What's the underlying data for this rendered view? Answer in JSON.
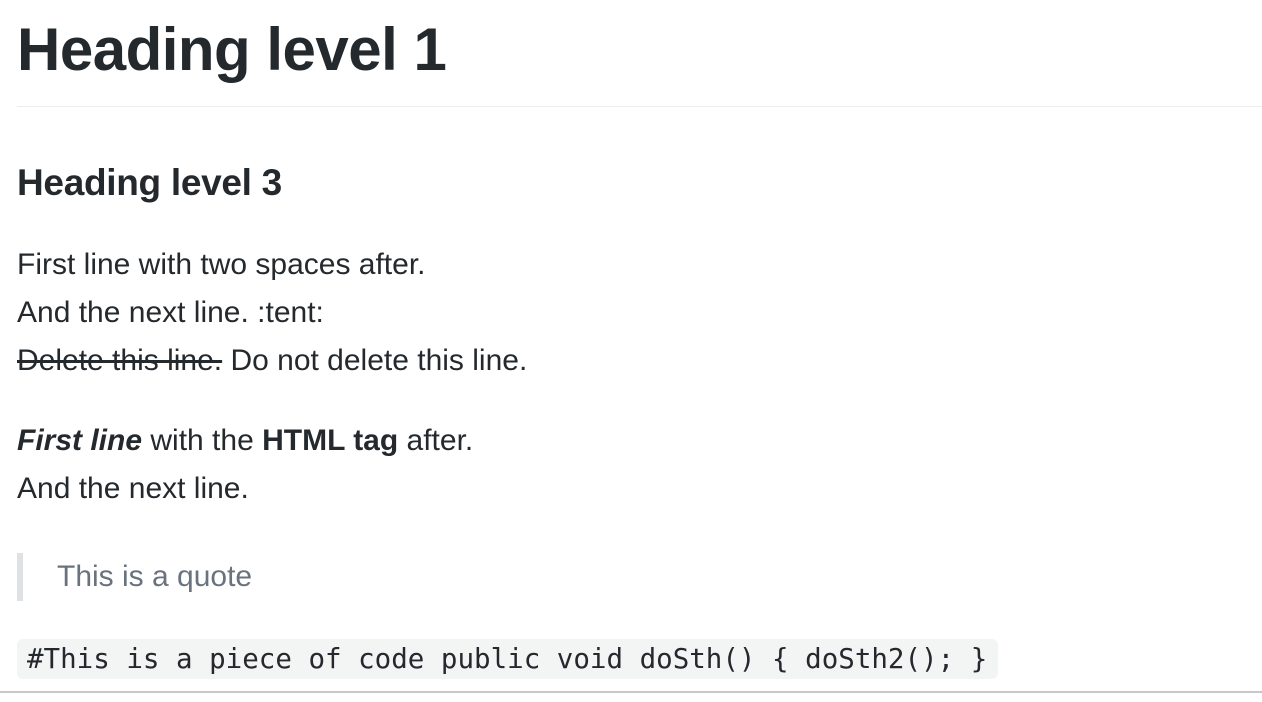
{
  "h1": "Heading level 1",
  "h3": "Heading level 3",
  "paragraph1": {
    "line1": "First line with two spaces after.",
    "line2": "And the next line. :tent:",
    "deleted": "Delete this line.",
    "kept": " Do not delete this line."
  },
  "paragraph2": {
    "italic_bold": "First line",
    "middle": " with the ",
    "bold": "HTML tag",
    "end": " after.",
    "line2": "And the next line."
  },
  "quote": "This is a quote",
  "code": "#This is a piece of code public void doSth() { doSth2(); }"
}
